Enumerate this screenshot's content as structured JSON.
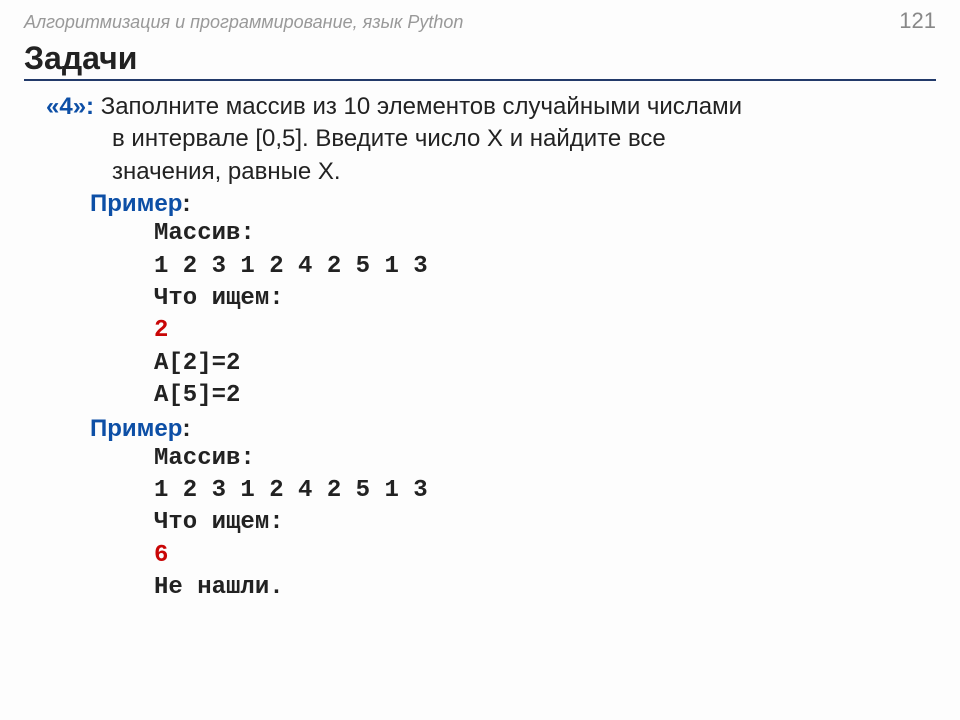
{
  "header": {
    "breadcrumb": "Алгоритмизация и программирование, язык Python",
    "page": "121"
  },
  "section_title": "Задачи",
  "task": {
    "grade": "«4»:",
    "line1": " Заполните массив из 10 элементов случайными числами",
    "line2": "в интервале [0,5]. Введите число X и найдите все",
    "line3": "значения, равные X."
  },
  "example_label": "Пример",
  "colon": ":",
  "ex1": {
    "arr_label": "Массив:",
    "arr_values": "1 2 3 1 2 4 2 5 1 3",
    "search_label": "Что ищем:",
    "search_value": "2",
    "result1": "A[2]=2",
    "result2": "A[5]=2"
  },
  "ex2": {
    "arr_label": "Массив:",
    "arr_values": "1 2 3 1 2 4 2 5 1 3",
    "search_label": "Что ищем:",
    "search_value": "6",
    "result": "Не нашли."
  }
}
